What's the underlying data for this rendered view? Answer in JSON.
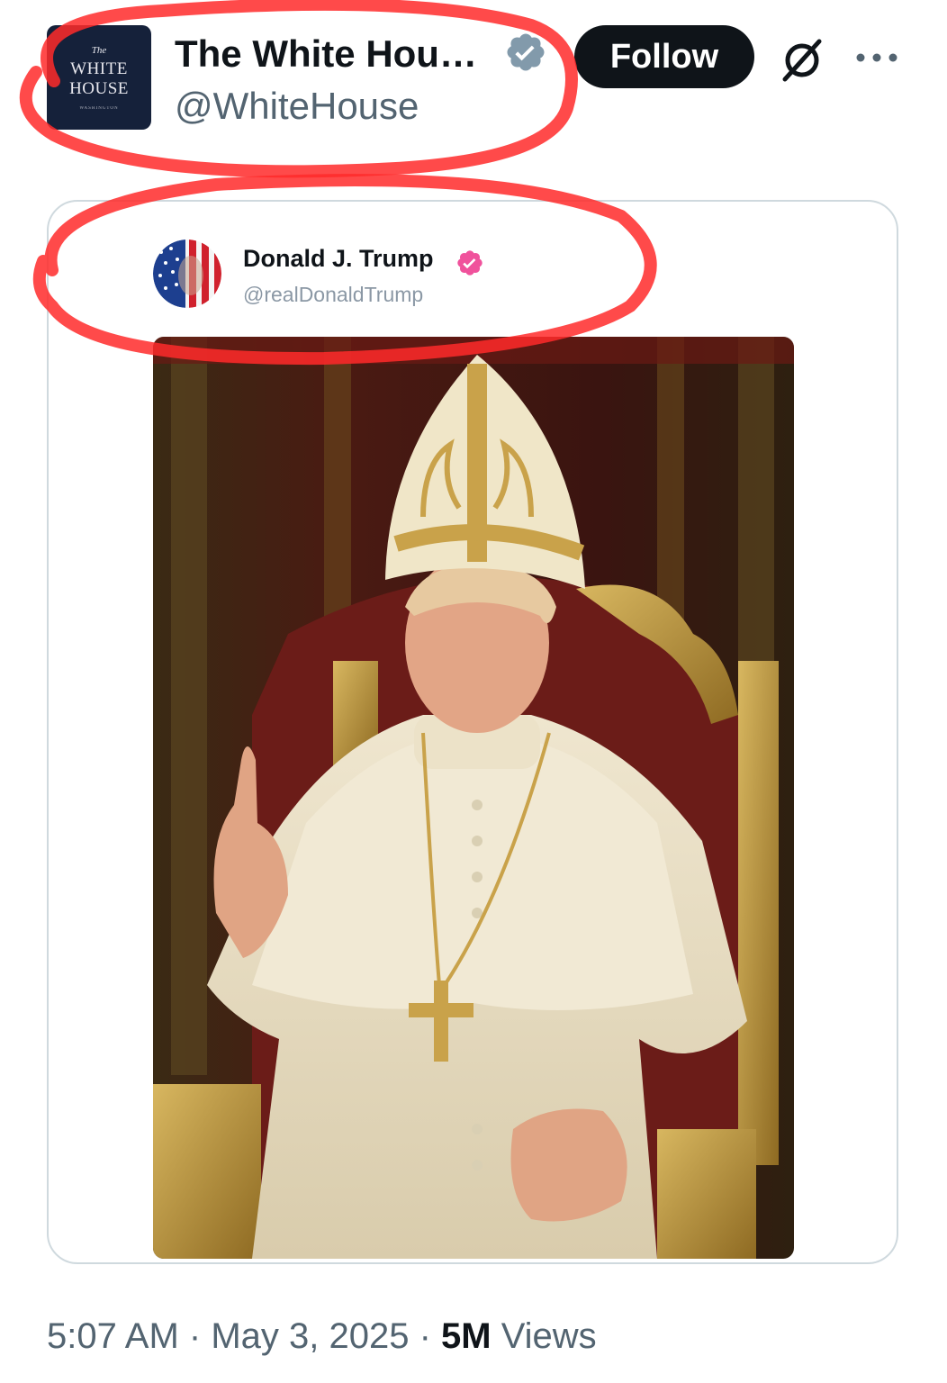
{
  "author": {
    "avatar_lines": [
      "The",
      "WHITE",
      "HOUSE",
      "WASHINGTON"
    ],
    "display_name": "The White Hou…",
    "handle": "@WhiteHouse",
    "verified_badge_color": "#829aab"
  },
  "actions": {
    "follow_label": "Follow",
    "grok_icon": "grok-icon",
    "more_icon": "more-icon"
  },
  "quote": {
    "display_name": "Donald J. Trump",
    "handle": "@realDonaldTrump",
    "verified_badge_color": "#f0529c"
  },
  "meta": {
    "time": "5:07 AM",
    "sep1": " · ",
    "date": "May 3, 2025",
    "sep2": " · ",
    "views_count": "5M",
    "views_label": " Views"
  },
  "colors": {
    "annotation": "#ff2a2a",
    "follow_bg": "#0f1419",
    "card_border": "#cfd9de"
  }
}
